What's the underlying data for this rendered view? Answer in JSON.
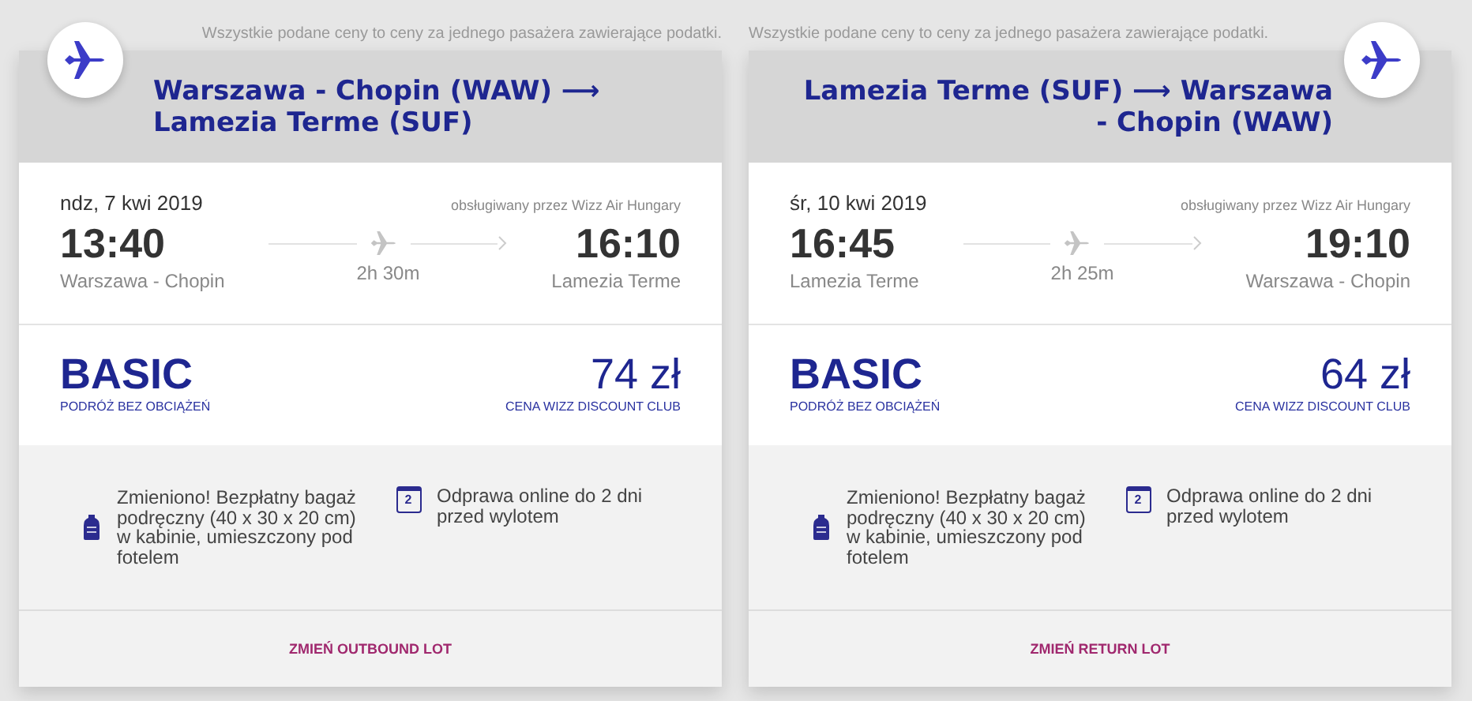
{
  "flights": [
    {
      "note": "Wszystkie podane ceny to ceny za jednego pasażera zawierające podatki.",
      "route": "Warszawa - Chopin (WAW) ⟶ Lamezia Terme (SUF)",
      "date": "ndz, 7 kwi 2019",
      "operator": "obsługiwany przez Wizz Air Hungary",
      "departure_time": "13:40",
      "departure_airport": "Warszawa - Chopin",
      "duration": "2h 30m",
      "arrival_time": "16:10",
      "arrival_airport": "Lamezia Terme",
      "fare": "BASIC",
      "fare_subtitle": "PODRÓŻ BEZ OBCIĄŻEŃ",
      "price": "74 zł",
      "price_label": "CENA WIZZ DISCOUNT CLUB",
      "perks": [
        {
          "kind": "bag",
          "text": "Zmieniono! Bezpłatny bagaż podręczny (40 x 30 x 20 cm) w kabinie, umieszczony pod fotelem"
        },
        {
          "kind": "calendar",
          "icon_digit": "2",
          "text": "Odprawa online do 2 dni przed wylotem"
        }
      ],
      "change_link": "ZMIEŃ OUTBOUND LOT"
    },
    {
      "note": "Wszystkie podane ceny to ceny za jednego pasażera zawierające podatki.",
      "route": "Lamezia Terme (SUF) ⟶ Warszawa - Chopin (WAW)",
      "date": "śr, 10 kwi 2019",
      "operator": "obsługiwany przez Wizz Air Hungary",
      "departure_time": "16:45",
      "departure_airport": "Lamezia Terme",
      "duration": "2h 25m",
      "arrival_time": "19:10",
      "arrival_airport": "Warszawa - Chopin",
      "fare": "BASIC",
      "fare_subtitle": "PODRÓŻ BEZ OBCIĄŻEŃ",
      "price": "64 zł",
      "price_label": "CENA WIZZ DISCOUNT CLUB",
      "perks": [
        {
          "kind": "bag",
          "text": "Zmieniono! Bezpłatny bagaż podręczny (40 x 30 x 20 cm) w kabinie, umieszczony pod fotelem"
        },
        {
          "kind": "calendar",
          "icon_digit": "2",
          "text": "Odprawa online do 2 dni przed wylotem"
        }
      ],
      "change_link": "ZMIEŃ RETURN LOT"
    }
  ]
}
